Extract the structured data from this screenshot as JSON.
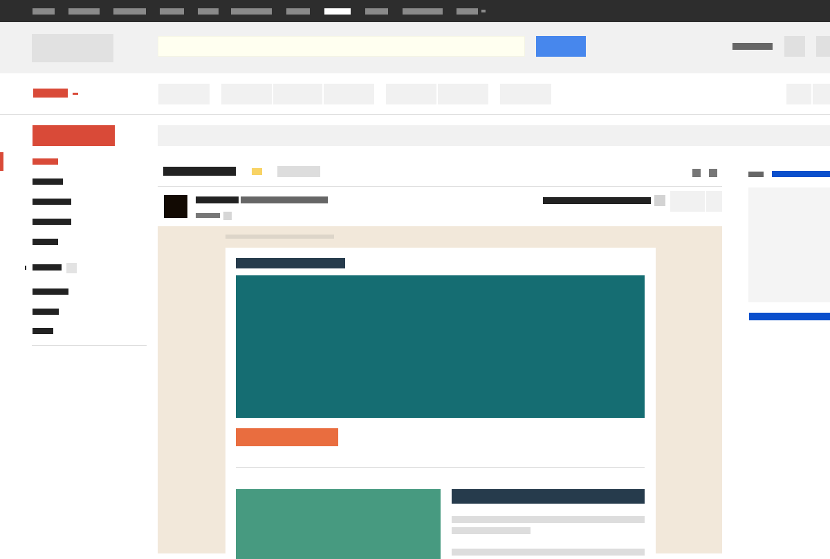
{
  "colors": {
    "topbar_bg": "#2d2d2d",
    "header_bg": "#f1f1f1",
    "brand_red": "#d94a38",
    "search_bg": "#fffff0",
    "search_button": "#4787ed",
    "email_bg": "#f2e8da",
    "hero_teal": "#156d72",
    "cta_orange": "#e96d3f",
    "heading_navy": "#263b4c",
    "card_green": "#479a80",
    "link_blue": "#0b4fcc",
    "star_yellow": "#f8d365"
  },
  "icons": {
    "search": "search-icon",
    "apps": "apps-grid-icon",
    "account": "avatar",
    "settings": "gear-icon",
    "print": "print-icon",
    "new_window": "new-window-icon",
    "important": "important-marker-icon"
  }
}
